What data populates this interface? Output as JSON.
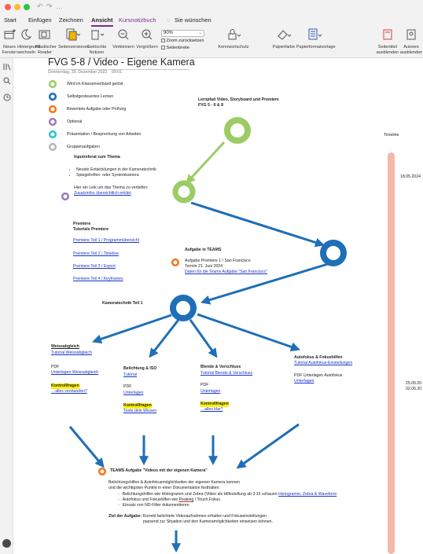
{
  "window": {
    "undo_glyph": "↶",
    "redo_glyph": "↷",
    "more_glyph": "…",
    "lights": [
      "#fe5f57",
      "#febc2e",
      "#28c840"
    ]
  },
  "tabs": [
    {
      "label": "Start"
    },
    {
      "label": "Einfügen"
    },
    {
      "label": "Zeichnen"
    },
    {
      "label": "Ansicht"
    },
    {
      "label": "Kursnotizbuch"
    },
    {
      "label": "Sie wünschen"
    }
  ],
  "ribbon": {
    "neues_fenster": "Neues\nFenster",
    "hintergrund": "Hintergrund\nwechseln",
    "plastischer_reader": "Plastischer\nReader",
    "seitenversionen": "Seitenversionen",
    "geloeschte_notizen": "Gelöschte\nNotizen",
    "verkleinern": "Verkleinern",
    "vergroessern": "Vergrößern",
    "zoom_value": "90%",
    "zoom_reset": "Zoom zurücksetzen",
    "seitenbreite": "Seitenbreite",
    "kennwortschutz": "Kennwortschutz",
    "papierfarbe": "Papierfarbe",
    "papierformatvorlage": "Papierformatvorlage",
    "seitentitel": "Seitentitel\nausblenden",
    "autoren": "Autoren\nausblenden"
  },
  "page": {
    "title": "FVG 5-8 / Video - Eigene Kamera",
    "date": "Donnerstag, 29. Dezember 2022",
    "time": "09:01",
    "legend": [
      {
        "label": "Wird im Klassenverband gelöst",
        "color": "#9ccc65"
      },
      {
        "label": "Selbstgesteuertes Lernen",
        "color": "#1e6fb7"
      },
      {
        "label": "Bewertete Aufgabe oder Prüfung",
        "color": "#f07a22"
      },
      {
        "label": "Optional",
        "color": "#9b7fb9"
      },
      {
        "label": "Präsentation / Besprechung von Arbeiten",
        "color": "#29c6d4"
      },
      {
        "label": "Gruppenaufgaben",
        "color": "#b7b7b7"
      }
    ],
    "lernpfad_title": "Lernpfad Video, Storyboard und Premiere",
    "lernpfad_sub": "FVG 5 - 6 & 8",
    "inputreferat": {
      "title": "Inputreferat zum Thema",
      "bullets": [
        "Neuste Entwicklungen in der Kameratechnik",
        "Spiegelreflex- oder Systemkamera"
      ],
      "hint": "Hier ein Link um das Thema zu vertiefen:",
      "link": "Zusatzinfos übersichtlich erklärt"
    },
    "premiere": {
      "title": "Premiere",
      "subtitle": "Tutorials Premiere",
      "links": [
        "Premiere Teil 1 / Programmübersicht",
        "Premiere Teil 2 / Timeline",
        "Premiere Teil 3 / Export",
        "Premiere Teil 4 / Keyframes"
      ]
    },
    "teams1": {
      "title": "Aufgabe in TEAMS",
      "line1": "Aufgabe Premiere 1 / San Francisco",
      "line2": "Termin 21. Juni 2024",
      "link": "Daten für die Teams Aufgabe \"San Francisco\""
    },
    "kameratechnik": "Kameratechnik Teil 1",
    "weissabgleich": {
      "title": "Weissabgleich",
      "tutorial": "Tutorial Weissabgleich",
      "pdf": "PDF",
      "unterlagen": "Unterlagen Weissabgleich",
      "kontroll": "Kontrollfragen",
      "kontroll_link": "…alles verstanden?"
    },
    "belichtung": {
      "title": "Belichtung & ISO",
      "tutorial": "Tutorial",
      "pdf": "PDF",
      "unterlagen": "Unterlagen",
      "kontroll": "Kontrollfragen",
      "kontroll_link": "Teste dein Wissen"
    },
    "blende": {
      "title": "Blende & Verschluss",
      "tutorial": "Tutorial Blende & Verschluss",
      "pdf": "PDF",
      "unterlagen": "Unterlagen",
      "kontroll": "Kontrollfragen",
      "kontroll_link": "…alles klar?"
    },
    "autofokus": {
      "title": "Autofokus & Fokushilfen",
      "tutorial": "Tutorial Autofokus-Einstellungen",
      "pdf": "PDF Unterlagen Autofokus",
      "unterlagen": "Unterlagen"
    },
    "teams2": {
      "title": "TEAMS Aufgabe \"Videos mit der eigenen Kamera\"",
      "p1": "Belichtungshilfen & Autofokusmöglichkeiten der eigenen Kamera kennen",
      "p2": "und die wichtigsten Punkte in einer Dokumentation festhalten:",
      "b1_pre": "Belichtungshilfen wie Histogramm und Zebra (Video als Hilfestellung ab 3:15 schauen ",
      "b1_link": "Histogramm, Zebra & Waveform",
      "b2_pre": "Autofokus und Fokushilfen wie ",
      "b2_mid": "Peaking",
      "b2_post": " / Touch Fokus",
      "b3": "Einsatz von ND-Filter dokumentieren",
      "ziel_label": "Ziel der Aufgabe:",
      "ziel_text": " Korrekt belichtete Videoaufnahmen erhalten und Fokuseinstellungen",
      "ziel_text2": "passend zur Situation und den Kameramöglichkeiten einsetzen können."
    },
    "timeline": {
      "label": "Timeline",
      "date1": "18.05.2024",
      "date2": "25.05.20",
      "date3": "02.06.20"
    }
  }
}
